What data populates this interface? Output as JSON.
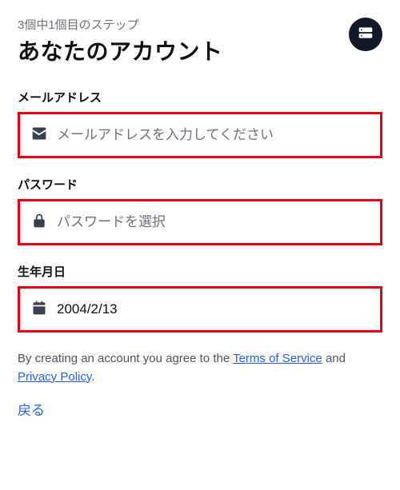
{
  "step": "3個中1個目のステップ",
  "title": "あなたのアカウント",
  "email": {
    "label": "メールアドレス",
    "placeholder": "メールアドレスを入力してください",
    "value": ""
  },
  "password": {
    "label": "パスワード",
    "placeholder": "パスワードを選択",
    "value": ""
  },
  "dob": {
    "label": "生年月日",
    "value": "2004/2/13"
  },
  "disclosure": {
    "prefix": "By creating an account you agree to the ",
    "terms": "Terms of Service",
    "and": " and ",
    "privacy": "Privacy Policy",
    "suffix": "."
  },
  "back": "戻る"
}
